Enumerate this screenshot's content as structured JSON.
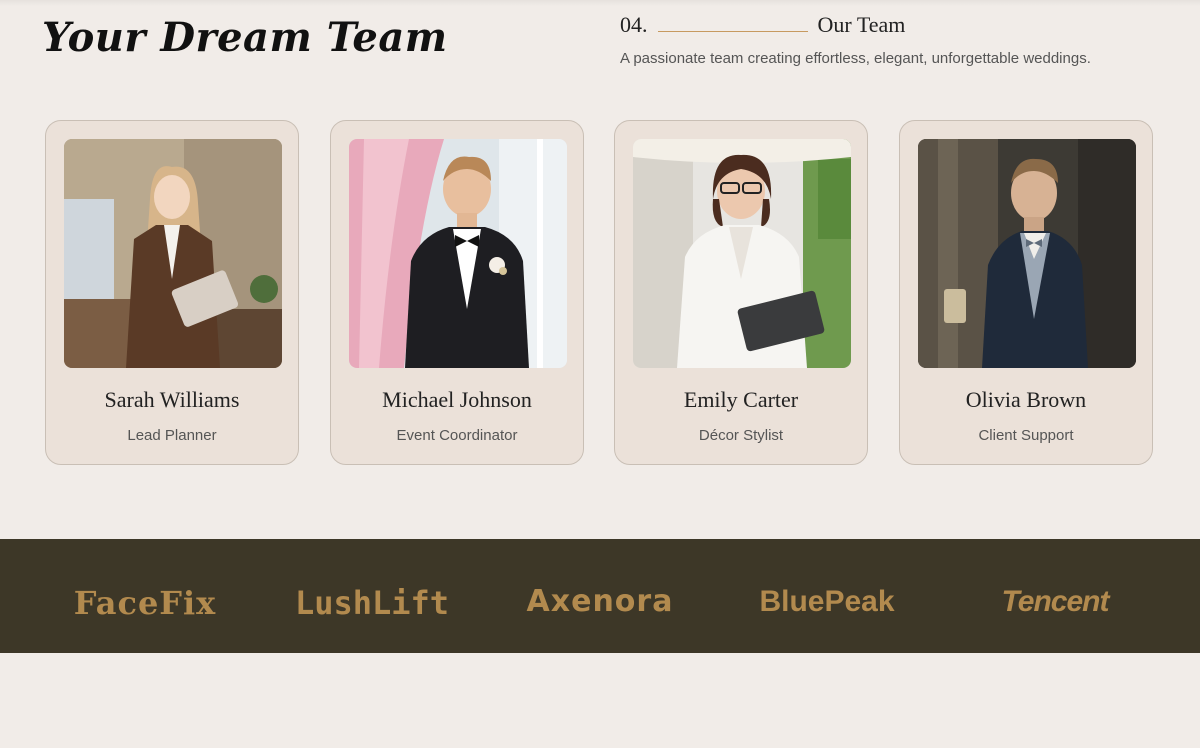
{
  "header": {
    "title": "Your Dream Team",
    "section_number": "04.",
    "section_label": "Our Team",
    "description": "A passionate team creating effortless, elegant, unforgettable weddings."
  },
  "team": [
    {
      "name": "Sarah Williams",
      "role": "Lead Planner"
    },
    {
      "name": "Michael Johnson",
      "role": "Event Coordinator"
    },
    {
      "name": "Emily Carter",
      "role": "Décor Stylist"
    },
    {
      "name": "Olivia Brown",
      "role": "Client Support"
    }
  ],
  "partners": [
    "FaceFix",
    "LushLift",
    "Axenora",
    "BluePeak",
    "Tencent"
  ],
  "colors": {
    "background": "#f1ece8",
    "card": "#ebe1d9",
    "accent": "#c79a60",
    "strip": "#3d3727",
    "logo": "#b28a4e"
  }
}
